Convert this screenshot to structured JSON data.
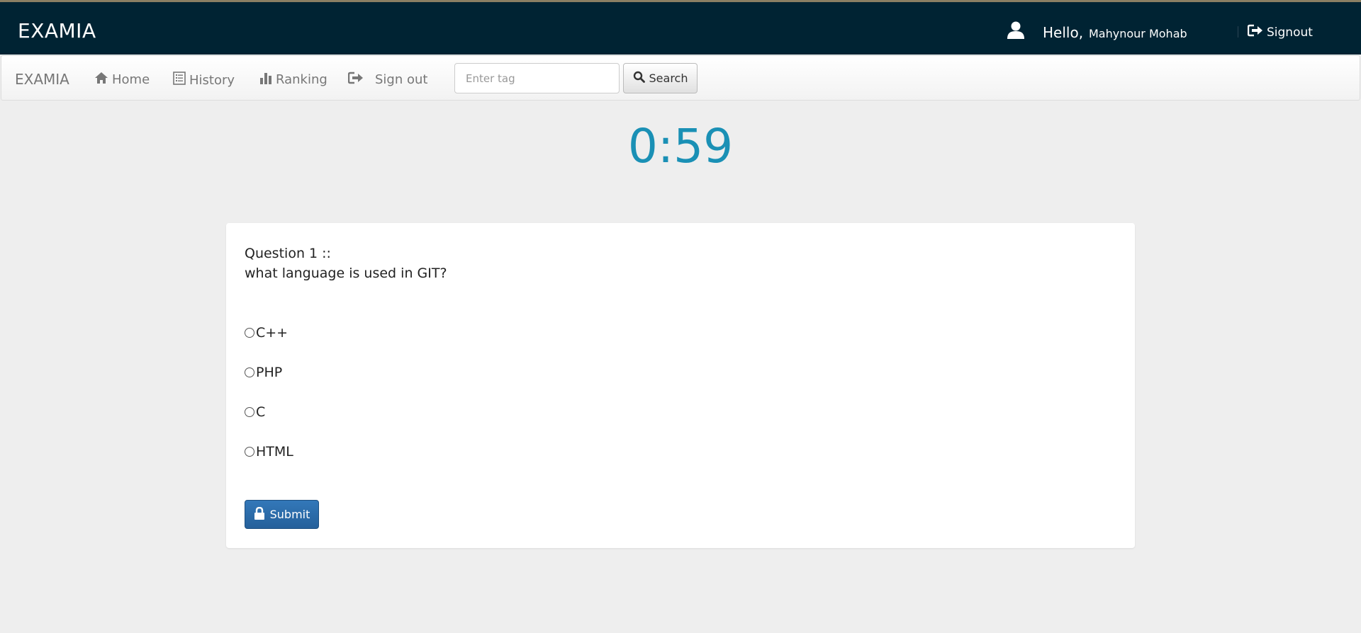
{
  "header": {
    "brand": "EXAMIA",
    "greeting": "Hello,",
    "username": "Mahynour Mohab",
    "signout_label": "Signout"
  },
  "nav": {
    "brand": "EXAMIA",
    "home_label": "Home",
    "history_label": "History",
    "ranking_label": "Ranking",
    "signout_label": "Sign out",
    "search": {
      "placeholder": "Enter tag",
      "value": "",
      "button_label": "Search"
    }
  },
  "timer": {
    "display": "0:59"
  },
  "quiz": {
    "question_label": "Question  1 ::",
    "question_text": "what language is used in GIT?",
    "options": [
      {
        "label": "C++"
      },
      {
        "label": "PHP"
      },
      {
        "label": "C"
      },
      {
        "label": "HTML"
      }
    ],
    "submit_label": "Submit"
  },
  "colors": {
    "header_bg": "#002333",
    "timer": "#1a90b5",
    "submit_bg": "#2d6ca8",
    "page_bg": "#eeeeee"
  },
  "icons": {
    "user": "user-icon",
    "signout": "sign-out-icon",
    "home": "home-icon",
    "history": "list-icon",
    "ranking": "bar-chart-icon",
    "search": "search-icon",
    "submit": "lock-icon"
  }
}
